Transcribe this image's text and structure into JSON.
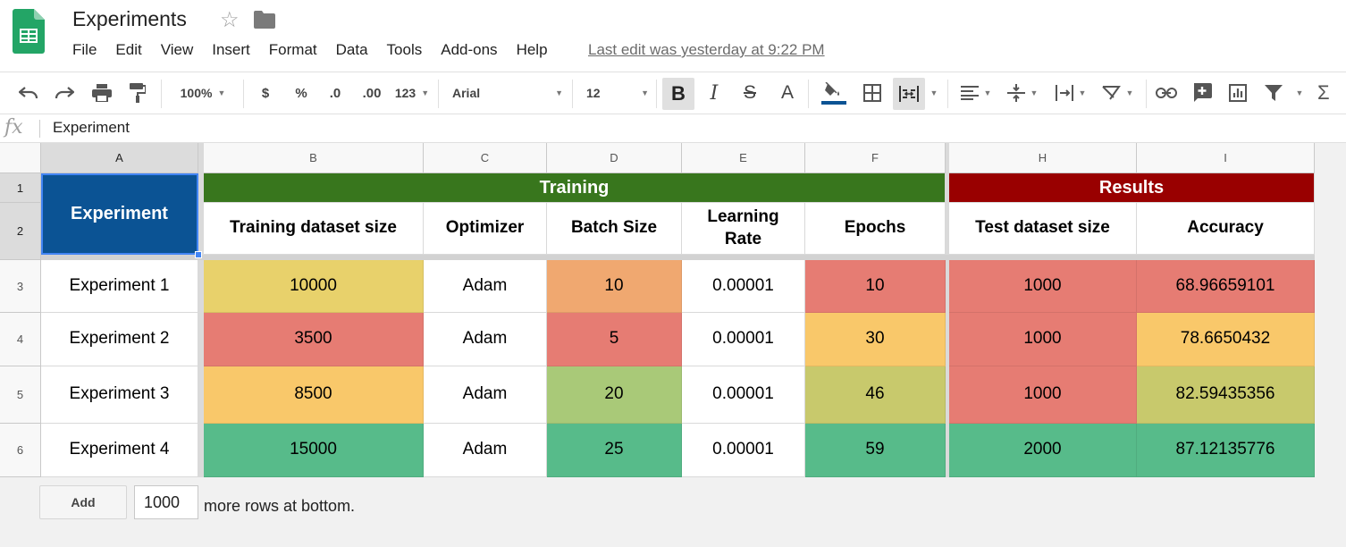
{
  "app": {
    "title": "Experiments",
    "menu": [
      "File",
      "Edit",
      "View",
      "Insert",
      "Format",
      "Data",
      "Tools",
      "Add-ons",
      "Help"
    ],
    "last_edit": "Last edit was yesterday at 9:22 PM"
  },
  "toolbar": {
    "zoom": "100%",
    "currency": "$",
    "percent": "%",
    "dec_decrease": ".0",
    "dec_increase": ".00",
    "more_formats": "123",
    "font": "Arial",
    "font_size": "12",
    "bold": "B",
    "italic": "I",
    "strike": "S",
    "text_color": "A",
    "fill_color_bar": "#0b5394"
  },
  "formula_bar": {
    "fx": "fx",
    "value": "Experiment"
  },
  "colors": {
    "experiment_header": "#0b5394",
    "training_header": "#38761d",
    "results_header": "#990000",
    "red": "#e67c73",
    "orange": "#f0a870",
    "yellow": "#e8d16b",
    "light_orange": "#f9c86a",
    "yellow_green": "#c8c96c",
    "light_green": "#a9c978",
    "green": "#57bb8a"
  },
  "sheet": {
    "columns": [
      "A",
      "B",
      "C",
      "D",
      "E",
      "F",
      "H",
      "I"
    ],
    "row_numbers": [
      "1",
      "2",
      "3",
      "4",
      "5",
      "6"
    ],
    "group_headers": {
      "experiment": "Experiment",
      "training": "Training",
      "results": "Results"
    },
    "field_headers": [
      "Training dataset size",
      "Optimizer",
      "Batch Size",
      "Learning Rate",
      "Epochs",
      "Test dataset size",
      "Accuracy"
    ],
    "rows": [
      {
        "name": "Experiment 1",
        "values": [
          "10000",
          "Adam",
          "10",
          "0.00001",
          "10",
          "1000",
          "68.96659101"
        ],
        "fills": [
          "yellow",
          "",
          "orange",
          "",
          "red",
          "red",
          "red"
        ]
      },
      {
        "name": "Experiment 2",
        "values": [
          "3500",
          "Adam",
          "5",
          "0.00001",
          "30",
          "1000",
          "78.6650432"
        ],
        "fills": [
          "red",
          "",
          "red",
          "",
          "light_orange",
          "red",
          "light_orange"
        ]
      },
      {
        "name": "Experiment 3",
        "values": [
          "8500",
          "Adam",
          "20",
          "0.00001",
          "46",
          "1000",
          "82.59435356"
        ],
        "fills": [
          "light_orange",
          "",
          "light_green",
          "",
          "yellow_green",
          "red",
          "yellow_green"
        ]
      },
      {
        "name": "Experiment 4",
        "values": [
          "15000",
          "Adam",
          "25",
          "0.00001",
          "59",
          "2000",
          "87.12135776"
        ],
        "fills": [
          "green",
          "",
          "green",
          "",
          "green",
          "green",
          "green"
        ]
      }
    ]
  },
  "footer": {
    "add_label": "Add",
    "rows_value": "1000",
    "rows_text": "more rows at bottom."
  }
}
